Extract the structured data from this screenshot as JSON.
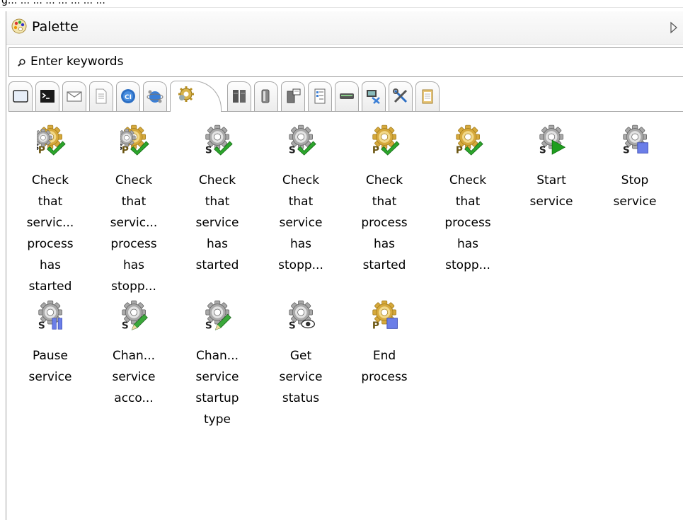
{
  "clipped_text": "g... ... ... ... ... ... ... ...",
  "palette": {
    "title": "Palette",
    "icon": "palette-icon",
    "collapse_icon": "chevron-right-icon"
  },
  "search": {
    "placeholder": "Enter keywords",
    "value": "",
    "icon": "search-icon"
  },
  "tabs": [
    {
      "icon": "window-icon",
      "active": false
    },
    {
      "icon": "terminal-icon",
      "active": false
    },
    {
      "icon": "mail-icon",
      "active": false
    },
    {
      "icon": "document-icon",
      "active": false
    },
    {
      "icon": "ci-icon",
      "active": false
    },
    {
      "icon": "network-globe-icon",
      "active": false
    },
    {
      "icon": "services-gear-icon",
      "active": true
    },
    {
      "icon": "server-rack-icon",
      "active": false
    },
    {
      "icon": "database-icon",
      "active": false
    },
    {
      "icon": "server-message-icon",
      "active": false
    },
    {
      "icon": "list-document-icon",
      "active": false
    },
    {
      "icon": "network-device-icon",
      "active": false
    },
    {
      "icon": "computer-tools-icon",
      "active": false
    },
    {
      "icon": "tools-icon",
      "active": false
    },
    {
      "icon": "clipboard-icon",
      "active": false
    }
  ],
  "items": [
    {
      "label": [
        "Check",
        "that",
        "servic...",
        "process",
        "has",
        "started"
      ],
      "icon": "service-process-started-icon"
    },
    {
      "label": [
        "Check",
        "that",
        "servic...",
        "process",
        "has",
        "stopp..."
      ],
      "icon": "service-process-stopped-icon"
    },
    {
      "label": [
        "Check",
        "that",
        "service",
        "has",
        "started"
      ],
      "icon": "service-started-icon"
    },
    {
      "label": [
        "Check",
        "that",
        "service",
        "has",
        "stopp..."
      ],
      "icon": "service-stopped-icon"
    },
    {
      "label": [
        "Check",
        "that",
        "process",
        "has",
        "started"
      ],
      "icon": "process-started-icon"
    },
    {
      "label": [
        "Check",
        "that",
        "process",
        "has",
        "stopp..."
      ],
      "icon": "process-stopped-icon"
    },
    {
      "label": [
        "Start",
        "service"
      ],
      "icon": "start-service-icon"
    },
    {
      "label": [
        "Stop",
        "service"
      ],
      "icon": "stop-service-icon"
    },
    {
      "label": [
        "Pause",
        "service"
      ],
      "icon": "pause-service-icon"
    },
    {
      "label": [
        "Chan...",
        "service",
        "acco..."
      ],
      "icon": "change-service-account-icon"
    },
    {
      "label": [
        "Chan...",
        "service",
        "startup",
        "type"
      ],
      "icon": "change-service-startup-icon"
    },
    {
      "label": [
        "Get",
        "service",
        "status"
      ],
      "icon": "get-service-status-icon"
    },
    {
      "label": [
        "End",
        "process"
      ],
      "icon": "end-process-icon"
    }
  ]
}
